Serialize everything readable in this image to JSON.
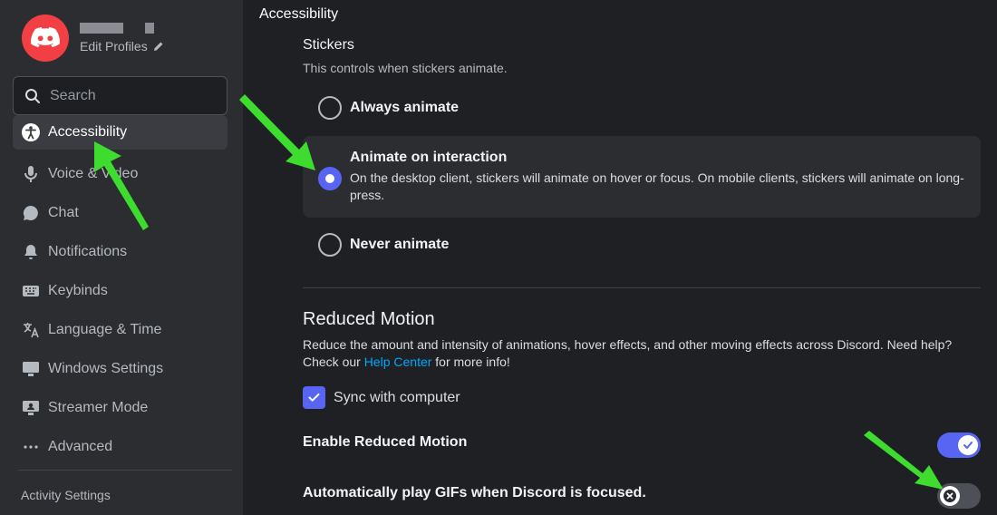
{
  "profile": {
    "edit_label": "Edit Profiles",
    "avatar_icon": "discord-logo-icon",
    "avatar_color": "#f23f43"
  },
  "search": {
    "placeholder": "Search"
  },
  "sidebar": {
    "items": [
      {
        "label": "Accessibility",
        "icon": "accessibility-icon",
        "active": true
      },
      {
        "label": "Voice & Video",
        "icon": "microphone-icon"
      },
      {
        "label": "Chat",
        "icon": "chat-bubble-icon"
      },
      {
        "label": "Notifications",
        "icon": "bell-icon"
      },
      {
        "label": "Keybinds",
        "icon": "keyboard-icon"
      },
      {
        "label": "Language & Time",
        "icon": "translate-icon"
      },
      {
        "label": "Windows Settings",
        "icon": "monitor-icon"
      },
      {
        "label": "Streamer Mode",
        "icon": "streamer-icon"
      },
      {
        "label": "Advanced",
        "icon": "ellipsis-icon"
      }
    ],
    "section_label": "Activity Settings"
  },
  "main": {
    "header": "Accessibility",
    "stickers": {
      "title": "Stickers",
      "description": "This controls when stickers animate.",
      "options": [
        {
          "label": "Always animate",
          "selected": false
        },
        {
          "label": "Animate on interaction",
          "selected": true,
          "description": "On the desktop client, stickers will animate on hover or focus. On mobile clients, stickers will animate on long-press."
        },
        {
          "label": "Never animate",
          "selected": false
        }
      ]
    },
    "reduced_motion": {
      "title": "Reduced Motion",
      "description_before": "Reduce the amount and intensity of animations, hover effects, and other moving effects across Discord. Need help? Check our ",
      "link": "Help Center",
      "description_after": " for more info!",
      "sync_label": "Sync with computer",
      "sync_checked": true,
      "enable_label": "Enable Reduced Motion",
      "enable_on": true,
      "gifs_label": "Automatically play GIFs when Discord is focused.",
      "gifs_on": false
    }
  },
  "colors": {
    "accent": "#5865f2",
    "annotation_arrow": "#3ddc2f",
    "link": "#00a8fc"
  }
}
